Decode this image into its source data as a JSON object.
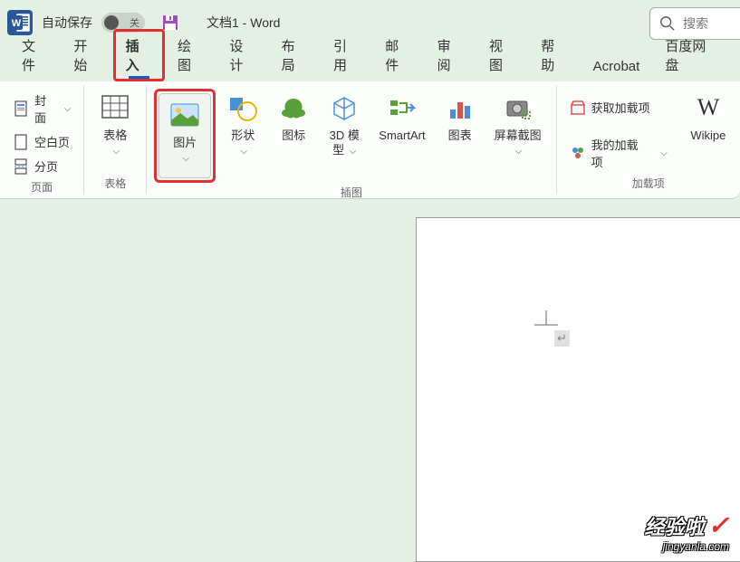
{
  "titlebar": {
    "autosave_label": "自动保存",
    "toggle_state": "关",
    "doc_title": "文档1  -  Word"
  },
  "search": {
    "placeholder": "搜索"
  },
  "tabs": [
    {
      "label": "文件",
      "active": false
    },
    {
      "label": "开始",
      "active": false
    },
    {
      "label": "插入",
      "active": true,
      "highlighted": true
    },
    {
      "label": "绘图",
      "active": false
    },
    {
      "label": "设计",
      "active": false
    },
    {
      "label": "布局",
      "active": false
    },
    {
      "label": "引用",
      "active": false
    },
    {
      "label": "邮件",
      "active": false
    },
    {
      "label": "审阅",
      "active": false
    },
    {
      "label": "视图",
      "active": false
    },
    {
      "label": "帮助",
      "active": false
    },
    {
      "label": "Acrobat",
      "active": false
    },
    {
      "label": "百度网盘",
      "active": false
    }
  ],
  "ribbon": {
    "groups": {
      "pages": {
        "label": "页面",
        "items": [
          {
            "label": "封面",
            "has_chev": true
          },
          {
            "label": "空白页",
            "has_chev": false
          },
          {
            "label": "分页",
            "has_chev": false
          }
        ]
      },
      "tables": {
        "label": "表格",
        "btn_label": "表格"
      },
      "illustrations": {
        "label": "插图",
        "buttons": [
          {
            "label": "图片",
            "highlighted": true
          },
          {
            "label": "形状"
          },
          {
            "label": "图标"
          },
          {
            "label": "3D 模\n型"
          },
          {
            "label": "SmartArt"
          },
          {
            "label": "图表"
          },
          {
            "label": "屏幕截图"
          }
        ]
      },
      "addins": {
        "label": "加载项",
        "items": [
          {
            "label": "获取加载项"
          },
          {
            "label": "我的加载项",
            "has_chev": true
          }
        ],
        "wiki_label": "Wikipe"
      }
    }
  },
  "watermark": {
    "main": "经验啦",
    "sub": "jingyanla.com"
  }
}
